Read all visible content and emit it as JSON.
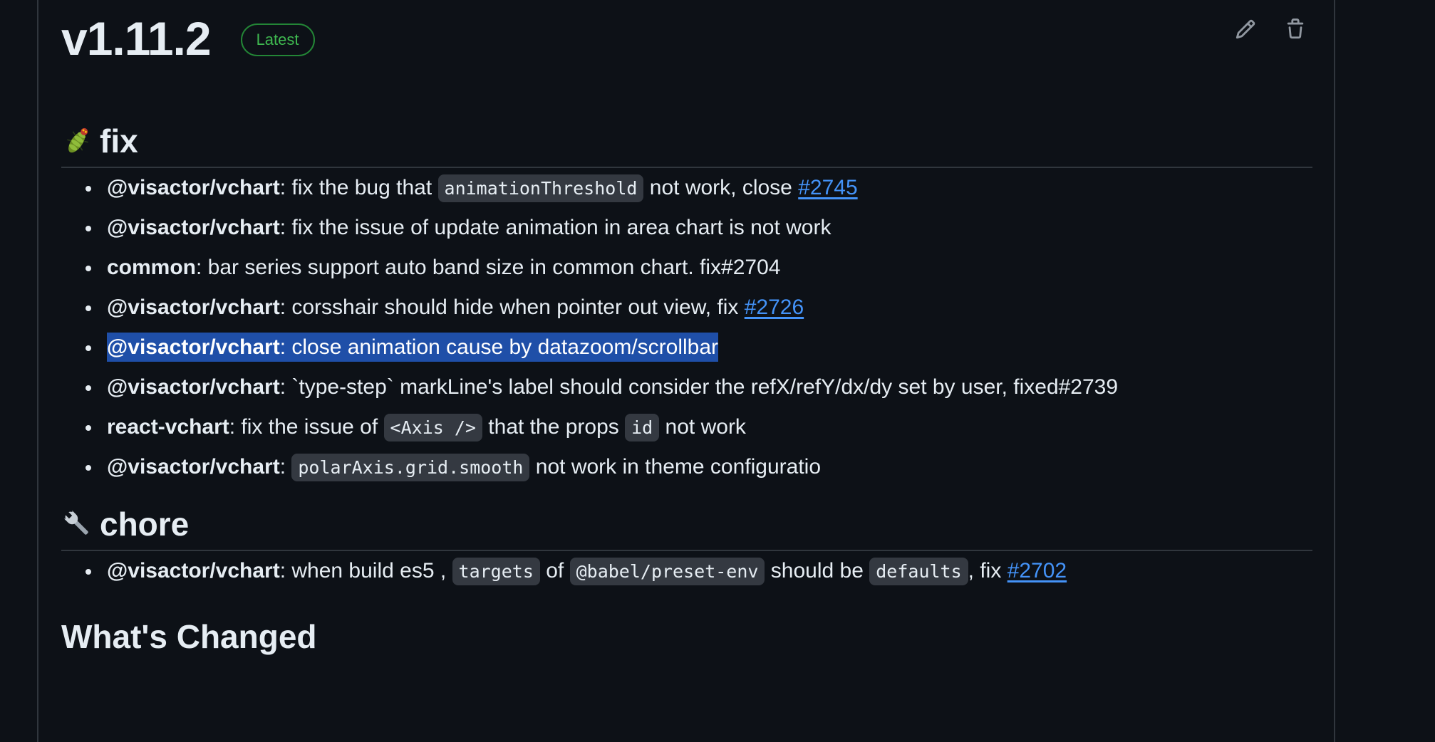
{
  "release": {
    "title": "v1.11.2",
    "badge": "Latest",
    "edit_label": "Edit",
    "delete_label": "Delete"
  },
  "fix_section": {
    "heading": "fix",
    "emoji": "bug-emoji",
    "items": [
      {
        "scope": "@visactor/vchart",
        "t1": ": fix the bug that ",
        "code1": "animationThreshold",
        "t2": " not work, close ",
        "link": "#2745"
      },
      {
        "scope": "@visactor/vchart",
        "t1": ": fix the issue of update animation in area chart is not work"
      },
      {
        "scope": "common",
        "t1": ": bar series support auto band size in common chart. fix#2704"
      },
      {
        "scope": "@visactor/vchart",
        "t1": ": corsshair should hide when pointer out view, fix ",
        "link": "#2726"
      },
      {
        "scope": "@visactor/vchart",
        "t1": ": close animation cause by datazoom/scrollbar",
        "selected": true
      },
      {
        "scope": "@visactor/vchart",
        "t1": ": `type-step` markLine's label should consider the refX/refY/dx/dy set by user, fixed#2739"
      },
      {
        "scope": "react-vchart",
        "t1": ": fix the issue of ",
        "code1": "<Axis />",
        "t2": " that the props ",
        "code2": "id",
        "t3": " not work"
      },
      {
        "scope": "@visactor/vchart",
        "t1": ": ",
        "code1": "polarAxis.grid.smooth",
        "t2": " not work in theme configuratio"
      }
    ]
  },
  "chore_section": {
    "heading": "chore",
    "emoji": "wrench-emoji",
    "items": [
      {
        "scope": "@visactor/vchart",
        "t1": ": when build es5 , ",
        "code1": "targets",
        "t2": " of ",
        "code2": "@babel/preset-env",
        "t3": " should be ",
        "code3": "defaults",
        "t4": ", fix ",
        "link": "#2702"
      }
    ]
  },
  "whats_changed": {
    "heading": "What's Changed"
  },
  "colors": {
    "background": "#0d1117",
    "text": "#e6edf3",
    "link": "#4493f8",
    "badge_green": "#3fb950",
    "selection": "#1f4fa8",
    "code_bg": "#343941"
  }
}
